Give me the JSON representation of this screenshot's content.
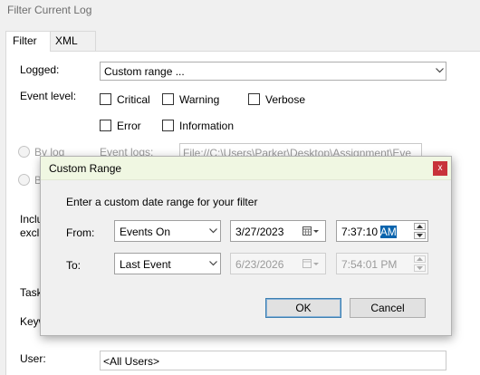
{
  "window": {
    "title": "Filter Current Log"
  },
  "tabs": [
    {
      "label": "Filter"
    },
    {
      "label": "XML"
    }
  ],
  "filter": {
    "logged_label": "Logged:",
    "logged_value": "Custom range ...",
    "event_level_label": "Event level:",
    "levels": {
      "critical": "Critical",
      "warning": "Warning",
      "verbose": "Verbose",
      "error": "Error",
      "information": "Information"
    },
    "by_log_label": "By log",
    "by_source_label": "B",
    "event_logs_label": "Event logs:",
    "event_logs_value": "File://C:\\Users\\Parker\\Desktop\\Assignment\\Eve",
    "include_label_1": "Inclu",
    "include_label_2": "exclu",
    "task_label": "Task",
    "keywords_label": "Keyw",
    "user_label": "User:",
    "user_value": "<All Users>"
  },
  "dialog": {
    "title": "Custom Range",
    "close_glyph": "x",
    "instructions": "Enter a custom date range for your filter",
    "from_label": "From:",
    "from_mode": "Events On",
    "from_date": "3/27/2023",
    "from_time_main": "7:37:10 ",
    "from_time_sel": "AM",
    "to_label": "To:",
    "to_mode": "Last Event",
    "to_date": "6/23/2026",
    "to_time": "7:54:01 PM",
    "ok_label": "OK",
    "cancel_label": "Cancel"
  }
}
